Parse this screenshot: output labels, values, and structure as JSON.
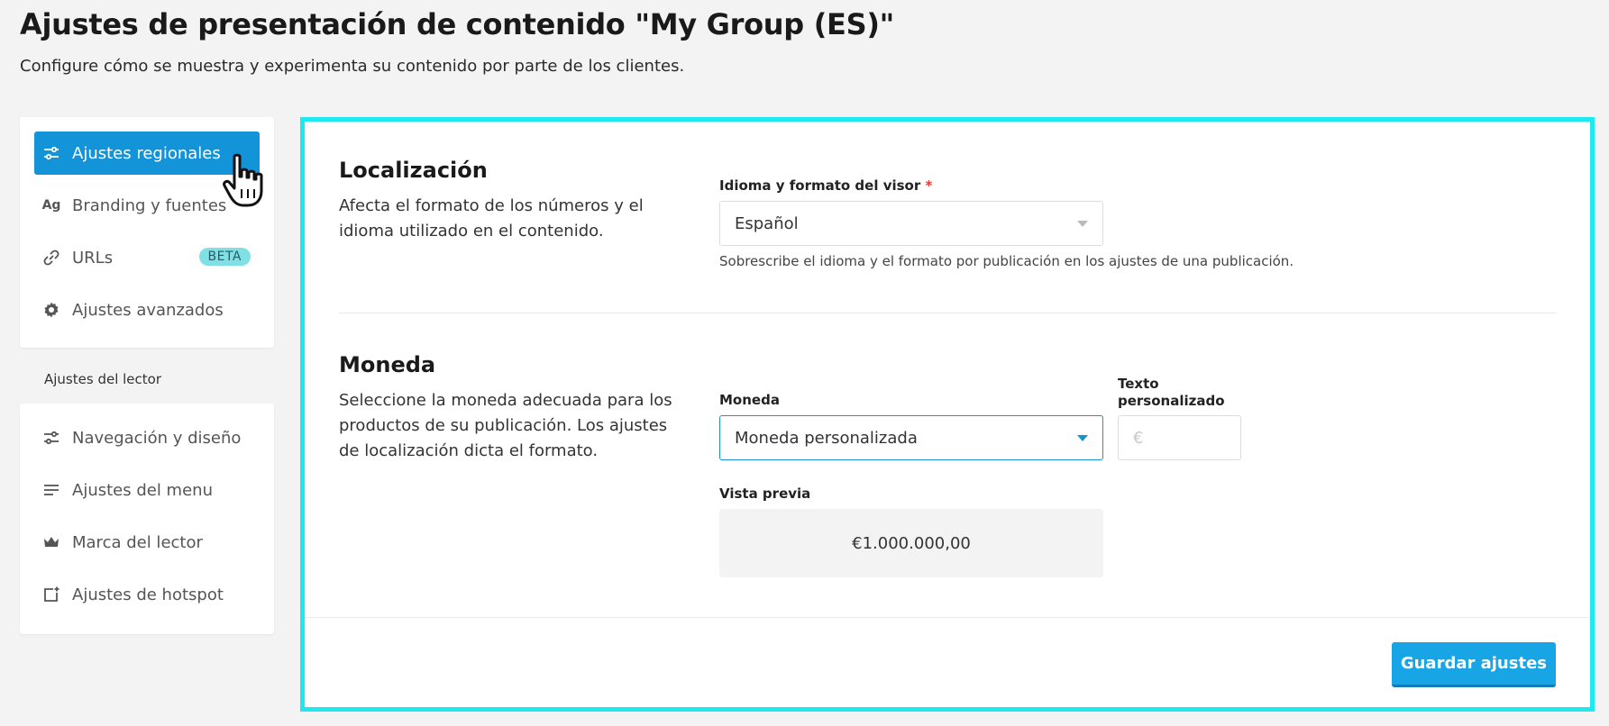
{
  "page": {
    "title": "Ajustes de presentación de contenido \"My Group (ES)\"",
    "subtitle": "Configure cómo se muestra y experimenta su contenido por parte de los clientes."
  },
  "nav": {
    "items": [
      {
        "label": "Ajustes regionales",
        "icon": "sliders-icon",
        "active": true
      },
      {
        "label": "Branding y fuentes",
        "icon": "typography-icon",
        "glyph": "Ag"
      },
      {
        "label": "URLs",
        "icon": "link-icon",
        "badge": "BETA"
      },
      {
        "label": "Ajustes avanzados",
        "icon": "gear-icon"
      }
    ],
    "reader_section_label": "Ajustes del lector",
    "reader_items": [
      {
        "label": "Navegación y diseño",
        "icon": "sliders-icon"
      },
      {
        "label": "Ajustes del menu",
        "icon": "menu-lines-icon"
      },
      {
        "label": "Marca del lector",
        "icon": "crown-icon"
      },
      {
        "label": "Ajustes de hotspot",
        "icon": "hotspot-add-icon"
      }
    ]
  },
  "localization": {
    "heading": "Localización",
    "description": "Afecta el formato de los números y el idioma utilizado en el contenido.",
    "field_label": "Idioma y formato del visor",
    "required_mark": "*",
    "selected": "Español",
    "helper": "Sobrescribe el idioma y el formato por publicación en los ajustes de una publicación."
  },
  "currency": {
    "heading": "Moneda",
    "description": "Seleccione la moneda adecuada para los productos de su publicación. Los ajustes de localización dicta el formato.",
    "field_label": "Moneda",
    "selected": "Moneda personalizada",
    "custom_text_label_line1": "Texto",
    "custom_text_label_line2": "personalizado",
    "custom_text_placeholder": "€",
    "preview_label": "Vista previa",
    "preview_value": "€1.000.000,00"
  },
  "footer": {
    "save_label": "Guardar ajustes"
  },
  "colors": {
    "accent": "#1393d8",
    "highlight_border": "#1ee8f0",
    "save_button": "#17a5e6",
    "badge": "#7fe0e6"
  }
}
